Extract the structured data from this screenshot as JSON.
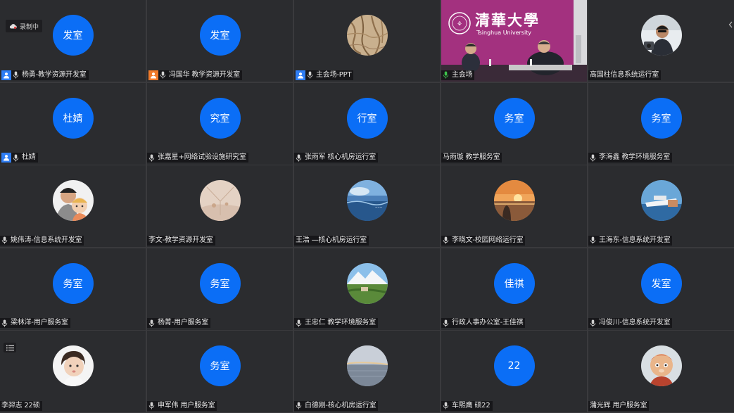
{
  "recording": {
    "label": "录制中"
  },
  "video_tile": {
    "logo_text": "清華大學",
    "logo_subtext": "Tsinghua University"
  },
  "participants": [
    {
      "name": "杨勇-教学资源开发室",
      "avatar_text": "发室",
      "avatar_type": "text",
      "badge": "blue",
      "mic": true
    },
    {
      "name": "冯国华 教学资源开发室",
      "avatar_text": "发室",
      "avatar_type": "text",
      "badge": "orange",
      "mic": true
    },
    {
      "name": "主会场-PPT",
      "avatar_text": "",
      "avatar_type": "photo-bark",
      "badge": "blue",
      "mic": true
    },
    {
      "name": "主会场",
      "avatar_text": "",
      "avatar_type": "video",
      "badge": "none",
      "mic": true,
      "mic_active": true
    },
    {
      "name": "高国柱信息系统运行室",
      "avatar_text": "",
      "avatar_type": "photo-man",
      "badge": "none",
      "mic": false
    },
    {
      "name": "杜婧",
      "avatar_text": "杜婧",
      "avatar_type": "text",
      "badge": "blue",
      "mic": true
    },
    {
      "name": "张嘉星+网络试验设施研究室",
      "avatar_text": "究室",
      "avatar_type": "text",
      "badge": "none",
      "mic": true
    },
    {
      "name": "张雨军 核心机房运行室",
      "avatar_text": "行室",
      "avatar_type": "text",
      "badge": "none",
      "mic": true
    },
    {
      "name": "马雨璇 教学服务室",
      "avatar_text": "务室",
      "avatar_type": "text",
      "badge": "none",
      "mic": false
    },
    {
      "name": "李海鑫 教学环境服务室",
      "avatar_text": "务室",
      "avatar_type": "text",
      "badge": "none",
      "mic": true
    },
    {
      "name": "姚伟涛-信息系统开发室",
      "avatar_text": "",
      "avatar_type": "photo-family",
      "badge": "none",
      "mic": true
    },
    {
      "name": "李文-教学资源开发室",
      "avatar_text": "",
      "avatar_type": "photo-sand",
      "badge": "none",
      "mic": false
    },
    {
      "name": "王浩 —核心机房运行室",
      "avatar_text": "",
      "avatar_type": "photo-sea",
      "badge": "none",
      "mic": false
    },
    {
      "name": "李晓文-校园网络运行室",
      "avatar_text": "",
      "avatar_type": "photo-sunset",
      "badge": "none",
      "mic": true
    },
    {
      "name": "王海东-信息系统开发室",
      "avatar_text": "",
      "avatar_type": "photo-ship",
      "badge": "none",
      "mic": true
    },
    {
      "name": "梁林洋-用户服务室",
      "avatar_text": "务室",
      "avatar_type": "text",
      "badge": "none",
      "mic": true
    },
    {
      "name": "杨菁-用户服务室",
      "avatar_text": "务室",
      "avatar_type": "text",
      "badge": "none",
      "mic": true
    },
    {
      "name": "王忠仁 教学环境服务室",
      "avatar_text": "",
      "avatar_type": "photo-mountain",
      "badge": "none",
      "mic": true
    },
    {
      "name": "行政人事办公室-王佳祺",
      "avatar_text": "佳祺",
      "avatar_type": "text",
      "badge": "none",
      "mic": true
    },
    {
      "name": "冯俊川-信息系统开发室",
      "avatar_text": "发室",
      "avatar_type": "text",
      "badge": "none",
      "mic": true
    },
    {
      "name": "李羿志 22硕",
      "avatar_text": "",
      "avatar_type": "photo-child",
      "badge": "none",
      "mic": false
    },
    {
      "name": "申军伟 用户服务室",
      "avatar_text": "务室",
      "avatar_type": "text",
      "badge": "none",
      "mic": true
    },
    {
      "name": "白德刚-核心机房运行室",
      "avatar_text": "",
      "avatar_type": "photo-lake",
      "badge": "none",
      "mic": true
    },
    {
      "name": "车熙鹰 硕22",
      "avatar_text": "22",
      "avatar_type": "text",
      "badge": "none",
      "mic": true
    },
    {
      "name": "蒲光辉 用户服务室",
      "avatar_text": "",
      "avatar_type": "photo-cartoon",
      "badge": "none",
      "mic": false
    }
  ],
  "colors": {
    "avatar_blue": "#0b6ef6",
    "tile_bg": "#2b2c2f",
    "badge_blue": "#2f7ef5",
    "badge_orange": "#f07a2a",
    "mic_active": "#3cc24a",
    "video_purple": "#9d2b7c"
  }
}
